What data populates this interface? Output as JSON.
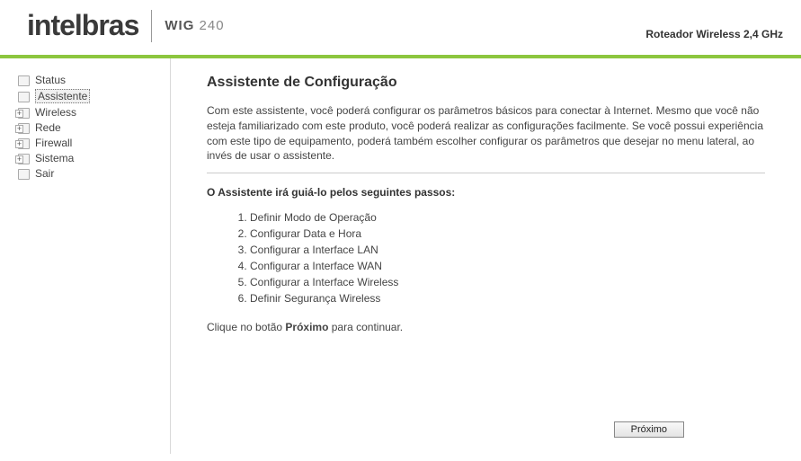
{
  "header": {
    "brand": "intelbras",
    "model_prefix": "WIG",
    "model_number": "240",
    "product_tag": "Roteador Wireless 2,4 GHz"
  },
  "sidebar": {
    "items": [
      {
        "label": "Status",
        "expandable": false,
        "selected": false
      },
      {
        "label": "Assistente",
        "expandable": false,
        "selected": true
      },
      {
        "label": "Wireless",
        "expandable": true,
        "selected": false
      },
      {
        "label": "Rede",
        "expandable": true,
        "selected": false
      },
      {
        "label": "Firewall",
        "expandable": true,
        "selected": false
      },
      {
        "label": "Sistema",
        "expandable": true,
        "selected": false
      },
      {
        "label": "Sair",
        "expandable": false,
        "selected": false
      }
    ]
  },
  "content": {
    "title": "Assistente de Configuração",
    "intro": "Com este assistente, você poderá configurar os parâmetros básicos para conectar à Internet. Mesmo que você não esteja familiarizado com este produto, você poderá realizar as configurações facilmente. Se você possui experiência com este tipo de equipamento, poderá também escolher configurar os parâmetros que desejar no menu lateral, ao invés de usar o assistente.",
    "steps_heading": "O Assistente irá guiá-lo pelos seguintes passos:",
    "steps": [
      "Definir Modo de Operação",
      "Configurar Data e Hora",
      "Configurar a Interface LAN",
      "Configurar a Interface WAN",
      "Configurar a Interface Wireless",
      "Definir Segurança Wireless"
    ],
    "click_next_prefix": "Clique no botão ",
    "click_next_bold": "Próximo",
    "click_next_suffix": " para continuar.",
    "next_button": "Próximo"
  }
}
